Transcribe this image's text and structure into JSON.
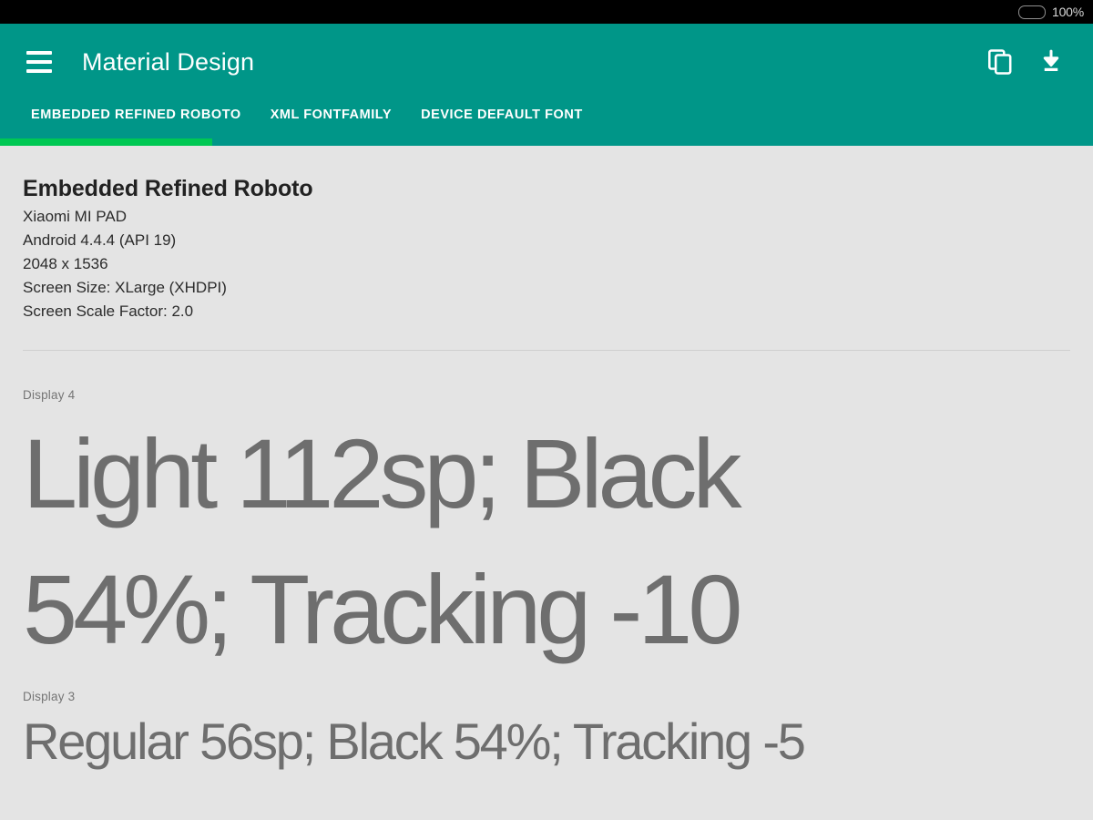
{
  "status_bar": {
    "battery_icon": "battery-full-icon",
    "battery_level": "100%",
    "battery_color": "#5ce316",
    "background": "#000000"
  },
  "app_bar": {
    "menu_icon": "hamburger-menu-icon",
    "title": "Material Design",
    "background": "#009688",
    "actions": [
      {
        "icon": "content-copy-icon",
        "name": "copy-action"
      },
      {
        "icon": "download-icon",
        "name": "download-action"
      }
    ]
  },
  "tabs": {
    "indicator_color": "#00c853",
    "items": [
      {
        "label": "EMBEDDED REFINED ROBOTO",
        "active": true
      },
      {
        "label": "XML FONTFAMILY",
        "active": false
      },
      {
        "label": "DEVICE DEFAULT FONT",
        "active": false
      }
    ]
  },
  "content": {
    "background": "#e4e4e4",
    "spec": {
      "title": "Embedded Refined Roboto",
      "lines": [
        "Xiaomi MI PAD",
        "Android 4.4.4 (API 19)",
        "2048 x 1536",
        "Screen Size: XLarge (XHDPI)",
        "Screen Scale Factor: 2.0"
      ]
    },
    "samples": [
      {
        "label": "Display 4",
        "text_line_1": "Light 112sp; Black",
        "text_line_2": "54%; Tracking -10",
        "text_color": "#6e6e6e"
      },
      {
        "label": "Display 3",
        "text": "Regular 56sp; Black 54%; Tracking -5",
        "text_color": "#6e6e6e"
      }
    ]
  }
}
